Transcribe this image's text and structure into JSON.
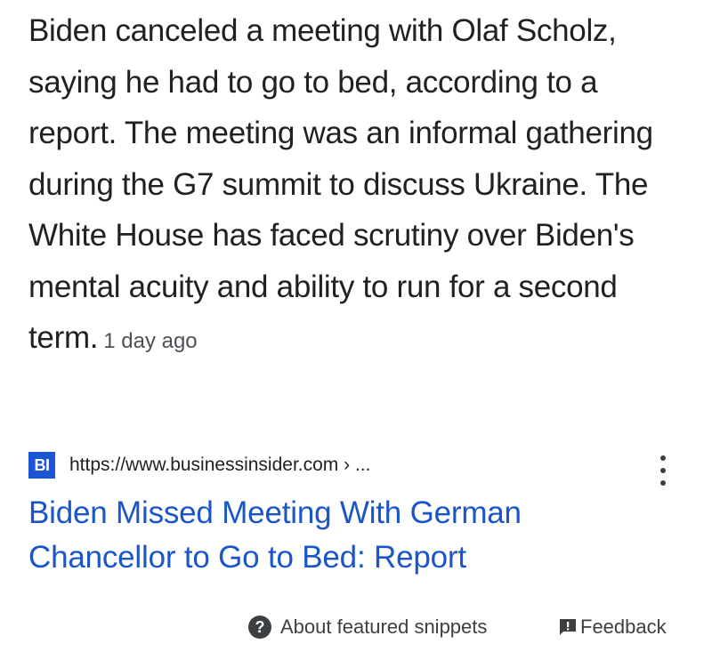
{
  "snippet": {
    "text": "Biden canceled a meeting with Olaf Scholz, saying he had to go to bed, according to a report. The meeting was an informal gathering during the G7 summit to discuss Ukraine. The White House has faced scrutiny over Biden's mental acuity and ability to run for a second term.",
    "date": "1 day ago"
  },
  "source": {
    "favicon_text": "BI",
    "favicon_color": "#1b56d6",
    "url": "https://www.businessinsider.com › ..."
  },
  "result": {
    "title": "Biden Missed Meeting With German Chancellor to Go to Bed: Report",
    "link_color": "#1a56c8"
  },
  "footer": {
    "about_label": "About featured snippets",
    "about_icon": "help-circle-icon",
    "feedback_label": "Feedback",
    "feedback_icon": "feedback-icon"
  }
}
